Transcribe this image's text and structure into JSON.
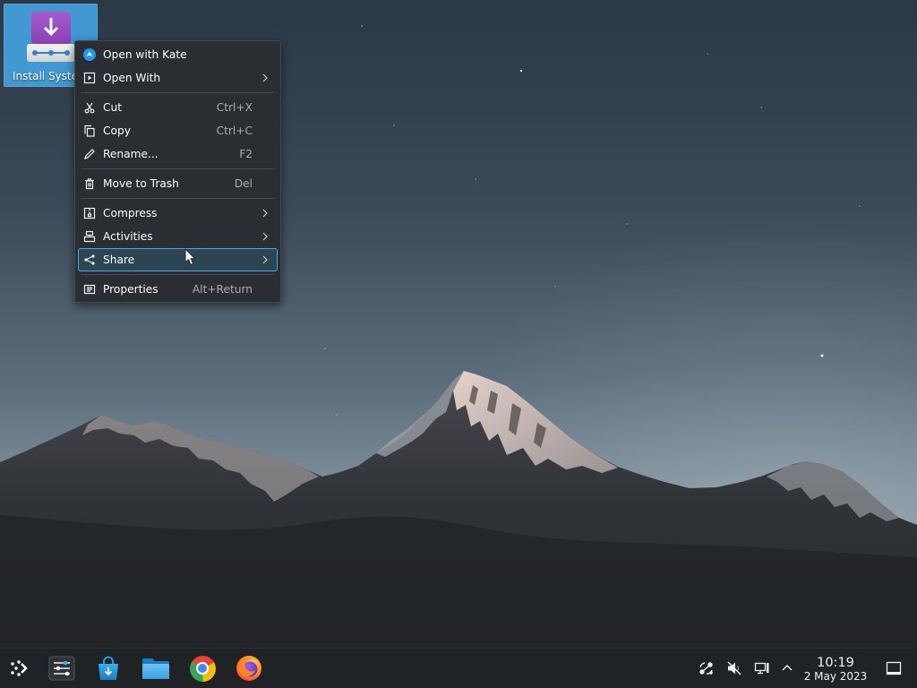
{
  "desktop": {
    "icons": [
      {
        "label": "Install Syste",
        "icon": "installer-icon",
        "selected": true
      }
    ]
  },
  "context_menu": {
    "groups": [
      [
        {
          "label": "Open with Kate",
          "icon": "kate-icon"
        },
        {
          "label": "Open With",
          "icon": "open-with-icon",
          "submenu": true
        }
      ],
      [
        {
          "label": "Cut",
          "shortcut": "Ctrl+X",
          "icon": "cut-icon"
        },
        {
          "label": "Copy",
          "shortcut": "Ctrl+C",
          "icon": "copy-icon"
        },
        {
          "label": "Rename...",
          "shortcut": "F2",
          "icon": "rename-icon"
        }
      ],
      [
        {
          "label": "Move to Trash",
          "shortcut": "Del",
          "icon": "trash-icon"
        }
      ],
      [
        {
          "label": "Compress",
          "icon": "compress-icon",
          "submenu": true
        },
        {
          "label": "Activities",
          "icon": "activities-icon",
          "submenu": true
        },
        {
          "label": "Share",
          "icon": "share-icon",
          "submenu": true,
          "highlighted": true
        }
      ],
      [
        {
          "label": "Properties",
          "shortcut": "Alt+Return",
          "icon": "properties-icon"
        }
      ]
    ]
  },
  "taskbar": {
    "launchers": [
      "application-launcher-icon",
      "system-settings-icon",
      "discover-icon",
      "file-manager-icon",
      "chrome-icon",
      "firefox-icon"
    ],
    "tray": {
      "icons": [
        "network-nodes-icon",
        "volume-muted-icon",
        "network-wired-icon",
        "chevron-up-icon"
      ],
      "clock": {
        "time": "10:19",
        "date": "2 May 2023"
      },
      "show_desktop": "show-desktop-icon"
    }
  },
  "cursor": {
    "icon": "arrow-cursor-icon"
  },
  "colors": {
    "accent": "#3daee9",
    "menu_bg": "#2a2e32",
    "taskbar_bg": "#202326",
    "text": "#fcfcfc",
    "shortcut_text": "#a7acb1",
    "icon_selection": "#4298d2"
  }
}
